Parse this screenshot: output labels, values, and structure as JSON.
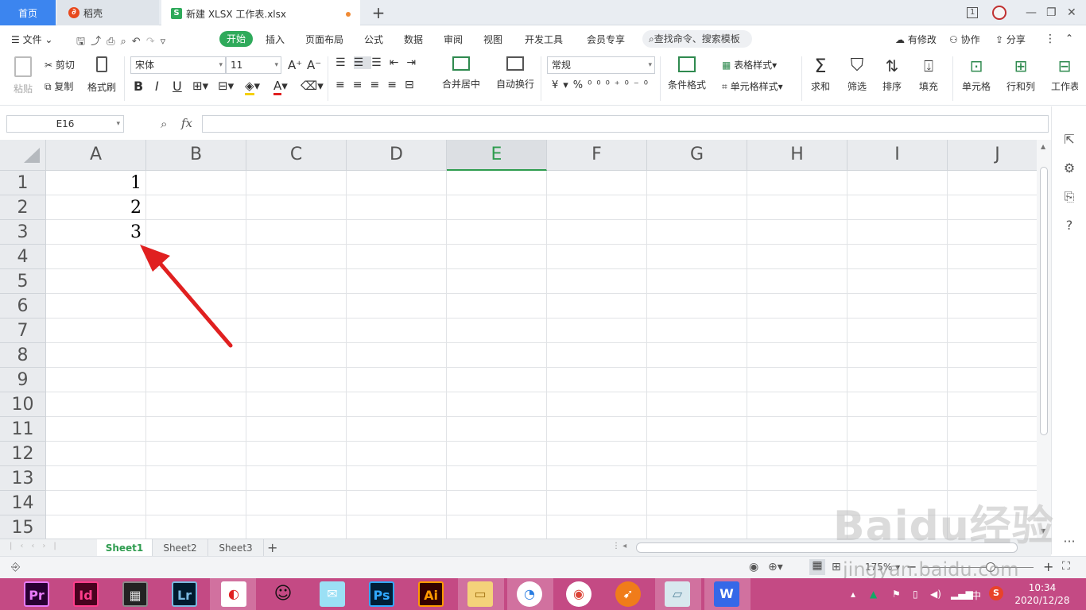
{
  "tabs": {
    "home": "首页",
    "daoke": "稻壳",
    "file": "新建 XLSX 工作表.xlsx",
    "add": "+"
  },
  "window": {
    "counter": "1",
    "minimize": "—",
    "restore": "❐",
    "close": "✕"
  },
  "menu": {
    "file": "文件",
    "start": "开始",
    "insert": "插入",
    "layout": "页面布局",
    "formula": "公式",
    "data": "数据",
    "review": "审阅",
    "view": "视图",
    "developer": "开发工具",
    "member": "会员专享",
    "search": "查找命令、搜索模板",
    "modified": "有修改",
    "collab": "协作",
    "share": "分享"
  },
  "ribbon": {
    "paste": "粘贴",
    "cut": "剪切",
    "copy": "复制",
    "format_painter": "格式刷",
    "font_name": "宋体",
    "font_size": "11",
    "merge_center": "合并居中",
    "wrap_text": "自动换行",
    "number_format": "常规",
    "conditional_format": "条件格式",
    "table_style": "表格样式",
    "cell_style": "单元格样式",
    "sum": "求和",
    "filter": "筛选",
    "sort": "排序",
    "fill": "填充",
    "cell": "单元格",
    "row_col": "行和列",
    "worksheet": "工作表"
  },
  "formula_bar": {
    "name_box": "E16",
    "fx": "fx",
    "value": ""
  },
  "sheet": {
    "columns": [
      "A",
      "B",
      "C",
      "D",
      "E",
      "F",
      "G",
      "H",
      "I",
      "J"
    ],
    "selected_column": "E",
    "rows": [
      "1",
      "2",
      "3",
      "4",
      "5",
      "6",
      "7",
      "8",
      "9",
      "10",
      "11",
      "12",
      "13",
      "14",
      "15"
    ],
    "cells": {
      "A1": "1",
      "A2": "2",
      "A3": "3"
    }
  },
  "sheet_tabs": [
    "Sheet1",
    "Sheet2",
    "Sheet3"
  ],
  "status": {
    "zoom": "175%"
  },
  "taskbar": {
    "apps": [
      "Pr",
      "Id",
      "Lr",
      "Ps",
      "Ai"
    ],
    "time": "10:34",
    "date": "2020/12/28",
    "ime": "中"
  },
  "watermark": {
    "brand": "Baidu经验",
    "url": "jingyan.baidu.com"
  },
  "colors": {
    "accent": "#2faa5b",
    "tab_home": "#3c85ef",
    "taskbar": "#c44a84",
    "arrow": "#e02020"
  }
}
